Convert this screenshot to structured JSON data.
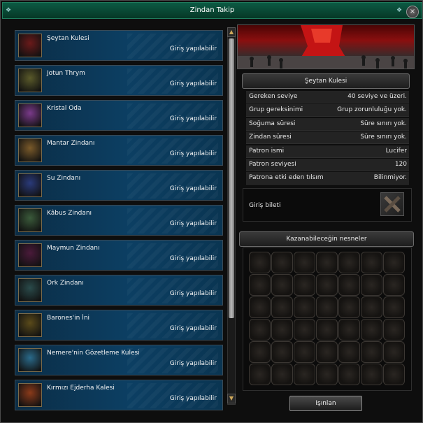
{
  "window": {
    "title": "Zindan Takip",
    "close_label": "×"
  },
  "dungeons": [
    {
      "name": "Şeytan Kulesi",
      "status": "Giriş yapılabilir",
      "thumb_color": "#6a1a1a"
    },
    {
      "name": "Jotun Thrym",
      "status": "Giriş yapılabilir",
      "thumb_color": "#5a5a2a"
    },
    {
      "name": "Kristal Oda",
      "status": "Giriş yapılabilir",
      "thumb_color": "#7a3a8a"
    },
    {
      "name": "Mantar Zindanı",
      "status": "Giriş yapılabilir",
      "thumb_color": "#7a5a2a"
    },
    {
      "name": "Su Zindanı",
      "status": "Giriş yapılabilir",
      "thumb_color": "#2a3a7a"
    },
    {
      "name": "Kâbus Zindanı",
      "status": "Giriş yapılabilir",
      "thumb_color": "#3a5a3a"
    },
    {
      "name": "Maymun Zindanı",
      "status": "Giriş yapılabilir",
      "thumb_color": "#4a1a3a"
    },
    {
      "name": "Ork Zindanı",
      "status": "Giriş yapılabilir",
      "thumb_color": "#2a4a4a"
    },
    {
      "name": "Barones'in İni",
      "status": "Giriş yapılabilir",
      "thumb_color": "#5a4a1a"
    },
    {
      "name": "Nemere'nin Gözetleme Kulesi",
      "status": "Giriş yapılabilir",
      "thumb_color": "#2a6a8a"
    },
    {
      "name": "Kırmızı Ejderha Kalesi",
      "status": "Giriş yapılabilir",
      "thumb_color": "#8a3a1a"
    }
  ],
  "detail": {
    "title": "Şeytan Kulesi",
    "rows": [
      {
        "key": "Gereken seviye",
        "value": "40 seviye ve üzeri."
      },
      {
        "key": "Grup gereksinimi",
        "value": "Grup zorunluluğu yok."
      },
      {
        "key": "Soğuma süresi",
        "value": "Süre sınırı yok."
      },
      {
        "key": "Zindan süresi",
        "value": "Süre sınırı yok."
      },
      {
        "key": "Patron ismi",
        "value": "Lucifer"
      },
      {
        "key": "Patron seviyesi",
        "value": "120"
      },
      {
        "key": "Patrona etki eden tılsım",
        "value": "Bilinmiyor."
      }
    ],
    "ticket_label": "Giriş bileti",
    "rewards_title": "Kazanabileceğin nesneler",
    "teleport_label": "Işınlan"
  }
}
